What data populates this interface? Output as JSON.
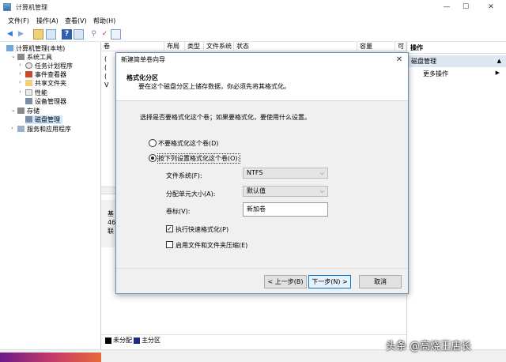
{
  "window": {
    "title": "计算机管理",
    "controls": [
      "—",
      "☐",
      "✕"
    ]
  },
  "menu": [
    "文件(F)",
    "操作(A)",
    "查看(V)",
    "帮助(H)"
  ],
  "tree": {
    "root": "计算机管理(本地)",
    "system_tools": "系统工具",
    "task_scheduler": "任务计划程序",
    "event_viewer": "事件查看器",
    "shared_folders": "共享文件夹",
    "performance": "性能",
    "device_manager": "设备管理器",
    "storage": "存储",
    "disk_management": "磁盘管理",
    "services_apps": "服务和应用程序"
  },
  "columns": [
    "卷",
    "布局",
    "类型",
    "文件系统",
    "状态",
    "容量",
    "可"
  ],
  "center_fragments": [
    "(",
    "(",
    "(",
    "V"
  ],
  "disk_info": [
    "基",
    "46",
    "联"
  ],
  "legend": {
    "unallocated": "未分配",
    "primary": "主分区",
    "unallocated_color": "#000000",
    "primary_color": "#1c2a8c"
  },
  "actions": {
    "header": "操作",
    "section": "磁盘管理",
    "more": "更多操作"
  },
  "dialog": {
    "title": "新建简单卷向导",
    "heading": "格式化分区",
    "subheading": "要在这个磁盘分区上储存数据，你必须先将其格式化。",
    "question": "选择是否要格式化这个卷；如果要格式化，要使用什么设置。",
    "opt_no_format": "不要格式化这个卷(D)",
    "opt_format": "按下列设置格式化这个卷(O):",
    "fs_label": "文件系统(F):",
    "fs_value": "NTFS",
    "alloc_label": "分配单元大小(A):",
    "alloc_value": "默认值",
    "vol_label": "卷标(V):",
    "vol_value": "新加卷",
    "quick_format": "执行快速格式化(P)",
    "compression": "启用文件和文件夹压缩(E)",
    "back": "< 上一步(B)",
    "next": "下一步(N) >",
    "cancel": "取消"
  },
  "watermark": "头条 @高烧王店长"
}
